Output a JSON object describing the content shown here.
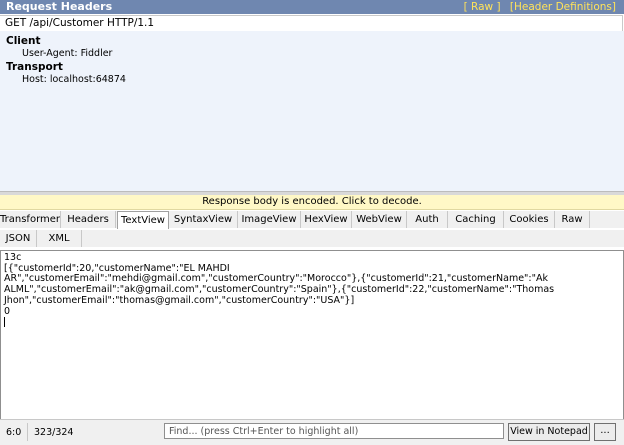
{
  "request": {
    "title": "Request Headers",
    "links": [
      "[ Raw ]",
      "[Header Definitions]"
    ],
    "request_line": "GET /api/Customer HTTP/1.1",
    "groups": [
      {
        "name": "Client",
        "items": [
          "User-Agent: Fiddler"
        ]
      },
      {
        "name": "Transport",
        "items": [
          "Host: localhost:64874"
        ]
      }
    ]
  },
  "notice": "Response body is encoded. Click to decode.",
  "tabs_row1": [
    "Transformer",
    "Headers",
    "TextView",
    "SyntaxView",
    "ImageView",
    "HexView",
    "WebView",
    "Auth",
    "Caching",
    "Cookies",
    "Raw"
  ],
  "tabs_row2": [
    "JSON",
    "XML"
  ],
  "active_tab": "TextView",
  "response_text": "13c\n[{\"customerId\":20,\"customerName\":\"EL MAHDI\nAR\",\"customerEmail\":\"mehdi@gmail.com\",\"customerCountry\":\"Morocco\"},{\"customerId\":21,\"customerName\":\"Ak\nALML\",\"customerEmail\":\"ak@gmail.com\",\"customerCountry\":\"Spain\"},{\"customerId\":22,\"customerName\":\"Thomas\nJhon\",\"customerEmail\":\"thomas@gmail.com\",\"customerCountry\":\"USA\"}]\n0",
  "status": {
    "position": "6:0",
    "count": "323/324",
    "find_placeholder": "Find... (press Ctrl+Enter to highlight all)",
    "notepad_label": "View in Notepad",
    "more_label": "..."
  }
}
